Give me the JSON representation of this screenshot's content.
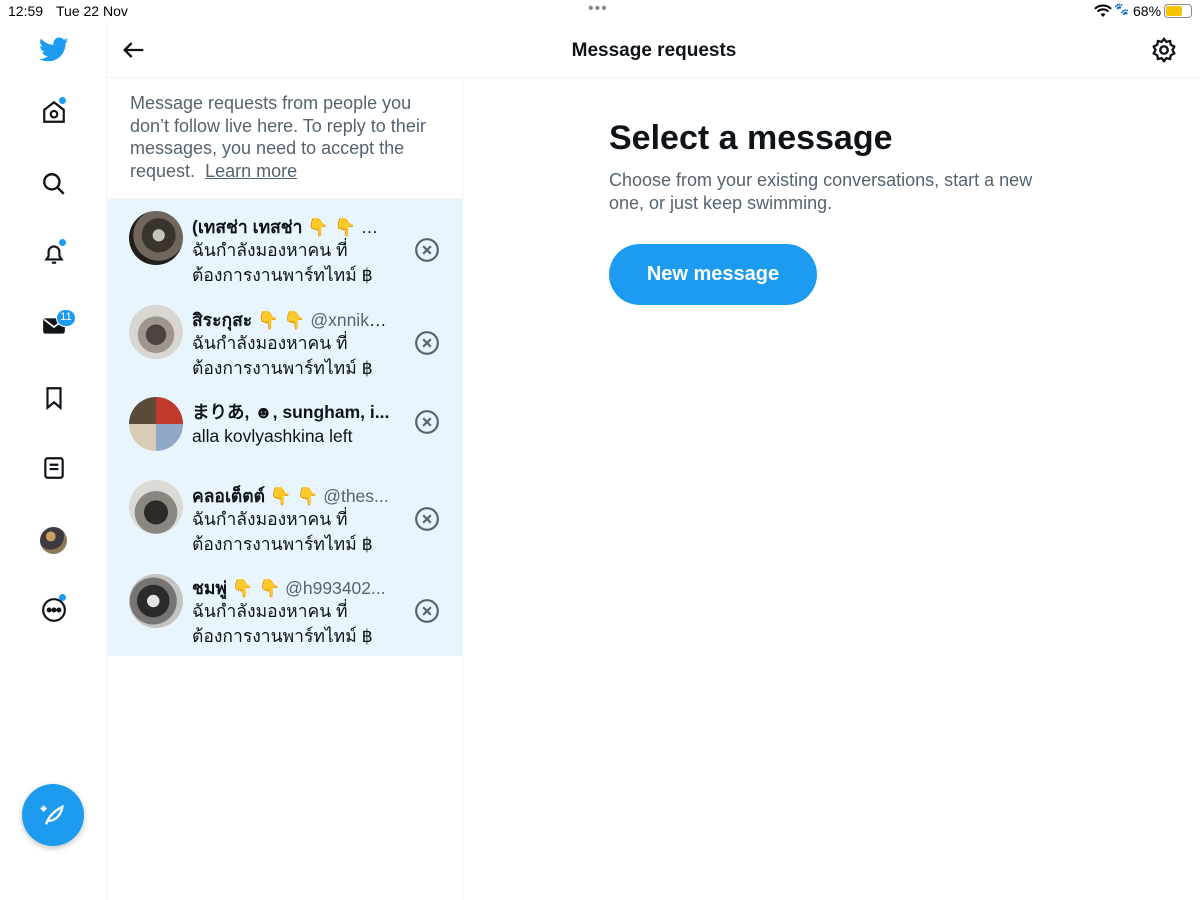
{
  "status_bar": {
    "time": "12:59",
    "date": "Tue 22 Nov",
    "multitask_dots": "•••",
    "battery_percent": "68%",
    "battery_level": 0.68
  },
  "rail": {
    "items": [
      {
        "name": "twitter-logo"
      },
      {
        "name": "home",
        "has_dot": true
      },
      {
        "name": "explore"
      },
      {
        "name": "notifications",
        "has_dot": true
      },
      {
        "name": "messages",
        "badge": "11"
      },
      {
        "name": "bookmarks"
      },
      {
        "name": "lists"
      },
      {
        "name": "profile"
      },
      {
        "name": "more",
        "has_dot": true
      }
    ],
    "accent_color": "#1d9bf0"
  },
  "header": {
    "title": "Message requests"
  },
  "intro": {
    "text": "Message requests from people you don’t follow live here. To reply to their messages, you need to accept the request.",
    "link": "Learn more"
  },
  "requests": [
    {
      "name": "(เทสช่า เทสช่า 👇 👇",
      "handle": " @...",
      "message": "ฉันกำลังมองหาคน ที่ต้องการงานพาร์ทไทม์ ฿"
    },
    {
      "name": "สิระกุสะ 👇 👇",
      "handle": " @xnnik8...",
      "message": "ฉันกำลังมองหาคน ที่ต้องการงานพาร์ทไทม์ ฿"
    },
    {
      "name": "まりあ, ☻, sungham, i...",
      "handle": "",
      "message": "alla kovlyashkina left"
    },
    {
      "name": "คลอเต็ตต์ 👇 👇",
      "handle": " @thes...",
      "message": "ฉันกำลังมองหาคน ที่ต้องการงานพาร์ทไทม์ ฿"
    },
    {
      "name": "ชมพู่ 👇 👇",
      "handle": " @h993402...",
      "message": "ฉันกำลังมองหาคน ที่ต้องการงานพาร์ทไทม์ ฿"
    }
  ],
  "detail": {
    "heading": "Select a message",
    "subtext": "Choose from your existing conversations, start a new one, or just keep swimming.",
    "button": "New message"
  }
}
